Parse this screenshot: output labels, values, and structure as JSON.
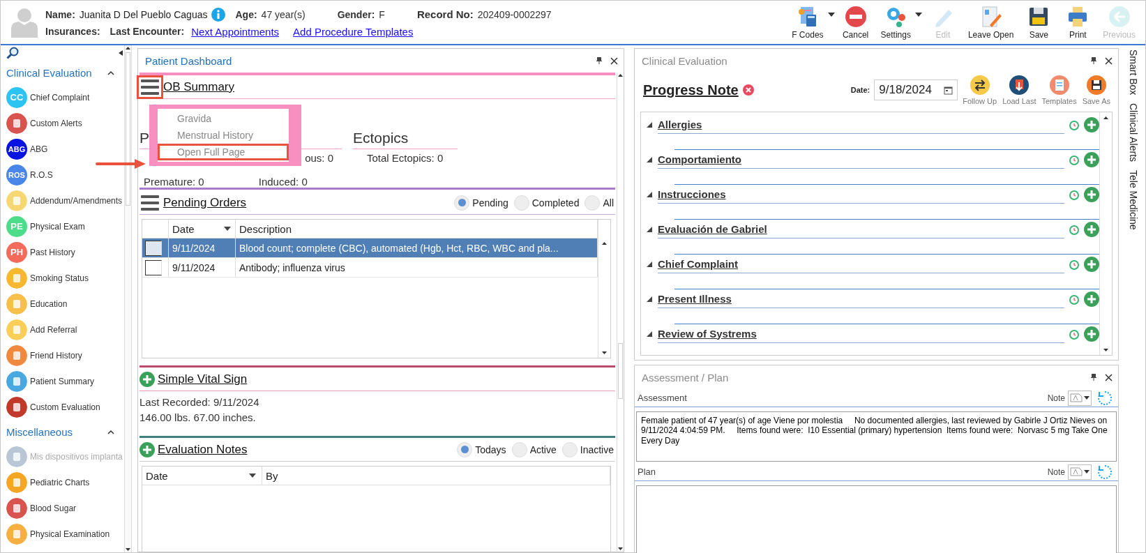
{
  "patient": {
    "name_label": "Name:",
    "name": "Juanita D Del Pueblo Caguas",
    "age_label": "Age:",
    "age": "47 year(s)",
    "gender_label": "Gender:",
    "gender": "F",
    "record_label": "Record No:",
    "record": "202409-0002297",
    "insurances_label": "Insurances:",
    "last_encounter_label": "Last Encounter:",
    "links": [
      "Next Appointments",
      "Add Procedure Templates"
    ]
  },
  "toolbar": [
    {
      "label": "F Codes",
      "kind": "fcodes",
      "dropdown": true,
      "disabled": false
    },
    {
      "label": "Cancel",
      "kind": "cancel",
      "dropdown": false,
      "disabled": false
    },
    {
      "label": "Settings",
      "kind": "settings",
      "dropdown": true,
      "disabled": false
    },
    {
      "label": "Edit",
      "kind": "edit",
      "dropdown": false,
      "disabled": true
    },
    {
      "label": "Leave Open",
      "kind": "leave",
      "dropdown": false,
      "disabled": false
    },
    {
      "label": "Save",
      "kind": "save",
      "dropdown": false,
      "disabled": false
    },
    {
      "label": "Print",
      "kind": "print",
      "dropdown": false,
      "disabled": false
    },
    {
      "label": "Previous",
      "kind": "previous",
      "dropdown": false,
      "disabled": true
    }
  ],
  "sidebar": {
    "sections": [
      {
        "title": "Clinical Evaluation",
        "expanded": true,
        "items": [
          {
            "label": "Chief Complaint",
            "badge": "CC",
            "color": "#2ec4f1",
            "disabled": false
          },
          {
            "label": "Custom Alerts",
            "color": "#d9534f",
            "disabled": false
          },
          {
            "label": "ABG",
            "badge": "ABG",
            "color": "#0a14e0",
            "disabled": false
          },
          {
            "label": "R.O.S",
            "badge": "ROS",
            "color": "#4a86e8",
            "disabled": false
          },
          {
            "label": "Addendum/Amendments",
            "color": "#f7d774",
            "disabled": false
          },
          {
            "label": "Physical Exam",
            "badge": "PE",
            "color": "#4cdc8a",
            "disabled": false
          },
          {
            "label": "Past History",
            "badge": "PH",
            "color": "#f26b5b",
            "disabled": false
          },
          {
            "label": "Smoking Status",
            "color": "#f5b82e",
            "disabled": false
          },
          {
            "label": "Education",
            "color": "#f7c04a",
            "disabled": false
          },
          {
            "label": "Add Referral",
            "color": "#f9cf5a",
            "disabled": false
          },
          {
            "label": "Friend History",
            "color": "#f0883e",
            "disabled": false
          },
          {
            "label": "Patient Summary",
            "color": "#4aa8e0",
            "disabled": false
          },
          {
            "label": "Custom Evaluation",
            "color": "#c0392b",
            "disabled": false
          }
        ]
      },
      {
        "title": "Miscellaneous",
        "expanded": true,
        "items": [
          {
            "label": "Mis dispositivos implanta",
            "color": "#b8c6d6",
            "disabled": true
          },
          {
            "label": "Pediatric Charts",
            "color": "#f5a623",
            "disabled": false
          },
          {
            "label": "Blood Sugar",
            "color": "#d9534f",
            "disabled": false
          },
          {
            "label": "Physical Examination",
            "color": "#f5b041",
            "disabled": false
          }
        ]
      }
    ]
  },
  "dashboard": {
    "title": "Patient Dashboard",
    "ob_summary": {
      "title": "OB Summary",
      "menu_button_highlighted": true,
      "heading_fragment": "P",
      "text_fragment": "ous: 0",
      "ectopics_title": "Ectopics",
      "total_ectopics": "Total Ectopics: 0",
      "premature": "Premature: 0",
      "induced": "Induced: 0",
      "menu": [
        {
          "label": "Gravida",
          "highlighted": false
        },
        {
          "label": "Menstrual History",
          "highlighted": false
        },
        {
          "label": "Open Full Page",
          "highlighted": true
        }
      ]
    },
    "pending_orders": {
      "title": "Pending Orders",
      "filters": [
        {
          "label": "Pending",
          "selected": true
        },
        {
          "label": "Completed",
          "selected": false
        },
        {
          "label": "All",
          "selected": false
        }
      ],
      "columns": [
        "Date",
        "Description"
      ],
      "rows": [
        {
          "date": "9/11/2024",
          "description": "Blood count; complete (CBC), automated (Hgb, Hct, RBC, WBC and pla...",
          "selected": true
        },
        {
          "date": "9/11/2024",
          "description": "Antibody; influenza virus",
          "selected": false
        }
      ]
    },
    "vital_sign": {
      "title": "Simple Vital Sign",
      "last_recorded": "Last Recorded: 9/11/2024",
      "values": "146.00 lbs. 67.00 inches."
    },
    "evaluation_notes": {
      "title": "Evaluation Notes",
      "filters": [
        {
          "label": "Todays",
          "selected": true
        },
        {
          "label": "Active",
          "selected": false
        },
        {
          "label": "Inactive",
          "selected": false
        }
      ],
      "columns": [
        "Date",
        "By"
      ]
    }
  },
  "clinical_evaluation": {
    "title": "Clinical Evaluation",
    "note_title": "Progress Note",
    "date_label": "Date:",
    "date": "9/18/2024",
    "actions": [
      {
        "label": "Follow Up",
        "kind": "follow"
      },
      {
        "label": "Load Last",
        "kind": "load"
      },
      {
        "label": "Templates",
        "kind": "templates"
      },
      {
        "label": "Save As",
        "kind": "saveas"
      }
    ],
    "sections": [
      {
        "title": "Allergies",
        "expanded": true
      },
      {
        "title": "Comportamiento",
        "expanded": true
      },
      {
        "title": "Instrucciones",
        "expanded": true
      },
      {
        "title": "Evaluación de Gabriel",
        "expanded": true
      },
      {
        "title": "Chief Complaint",
        "expanded": true
      },
      {
        "title": "Present Illness",
        "expanded": true
      },
      {
        "title": "Review of Systrems",
        "expanded": true
      }
    ]
  },
  "assessment_plan": {
    "title": "Assessment / Plan",
    "fields": [
      {
        "label": "Assessment",
        "note_label": "Note",
        "value": "Female patient of 47 year(s) of age Viene por molestia     No documented allergies, last reviewed by Gabirle J Ortiz Nieves on 9/11/2024 4:04:59 PM.     Items found were:  I10 Essential (primary) hypertension  Items found were:  Norvasc 5 mg Take One Every Day"
      },
      {
        "label": "Plan",
        "note_label": "Note"
      }
    ]
  },
  "side_tabs": [
    "Smart Box",
    "Clinical Alerts",
    "Tele Medicine"
  ]
}
